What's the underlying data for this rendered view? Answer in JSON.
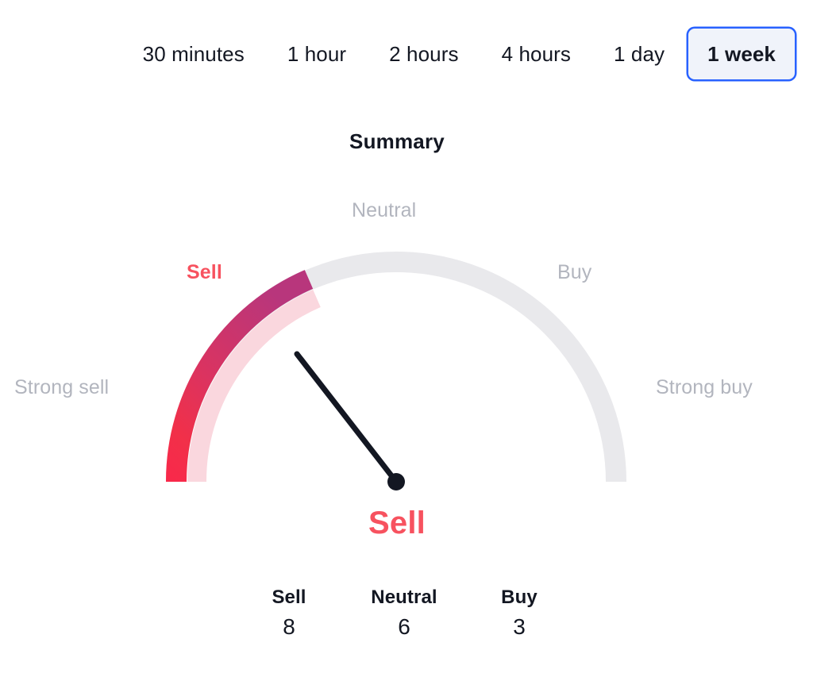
{
  "intervals": {
    "name": "timeframe-tabs",
    "options": [
      {
        "label": "30 minutes",
        "selected": false
      },
      {
        "label": "1 hour",
        "selected": false
      },
      {
        "label": "2 hours",
        "selected": false
      },
      {
        "label": "4 hours",
        "selected": false
      },
      {
        "label": "1 day",
        "selected": false
      },
      {
        "label": "1 week",
        "selected": true
      }
    ],
    "selected_label": "1 week"
  },
  "summary": {
    "title": "Summary",
    "verdict": "Sell"
  },
  "chart_data": {
    "type": "gauge",
    "title": "Summary",
    "value_label": "Sell",
    "zones": [
      {
        "label": "Strong sell",
        "color": "#f23645"
      },
      {
        "label": "Sell",
        "color": "#f7525f"
      },
      {
        "label": "Neutral",
        "color": "#b2b5be"
      },
      {
        "label": "Buy",
        "color": "#b2b5be"
      },
      {
        "label": "Strong buy",
        "color": "#b2b5be"
      }
    ],
    "needle_zone": "Sell",
    "needle_angle_deg": 232,
    "arc_start_deg": 180,
    "arc_end_deg": 127,
    "track_color": "#e9e9ec",
    "active_gradient_from": "#f23645",
    "active_gradient_to": "#bc3375",
    "active_inner_color": "#fad7de",
    "counts": {
      "categories": [
        "Sell",
        "Neutral",
        "Buy"
      ],
      "values": [
        8,
        6,
        3
      ]
    }
  },
  "labels": {
    "strong_sell": "Strong sell",
    "sell": "Sell",
    "neutral": "Neutral",
    "buy": "Buy",
    "strong_buy": "Strong buy"
  },
  "counters": [
    {
      "label": "Sell",
      "value": "8"
    },
    {
      "label": "Neutral",
      "value": "6"
    },
    {
      "label": "Buy",
      "value": "3"
    }
  ]
}
